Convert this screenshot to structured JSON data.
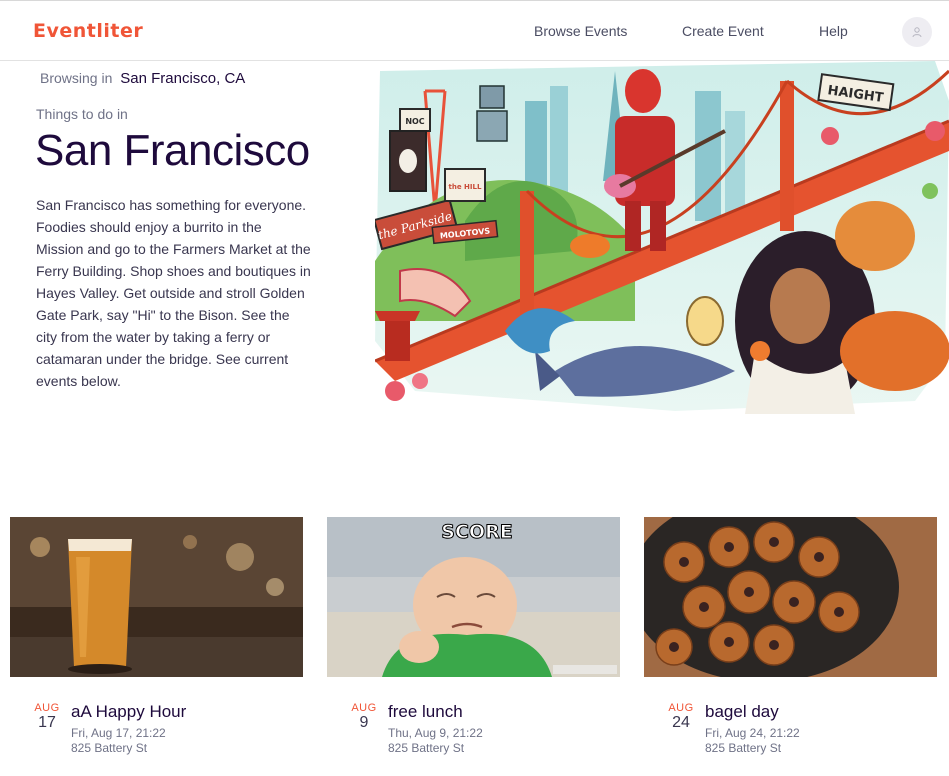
{
  "header": {
    "logo": "Eventliter",
    "nav": [
      {
        "label": "Browse Events"
      },
      {
        "label": "Create Event"
      },
      {
        "label": "Help"
      }
    ]
  },
  "hero": {
    "browsing_label": "Browsing in",
    "browsing_city": "San Francisco, CA",
    "things_label": "Things to do in",
    "city": "San Francisco",
    "description": "San Francisco has something for everyone. Foodies should enjoy a burrito in the Mission and go to the Farmers Market at the Ferry Building. Shop shoes and boutiques in Hayes Valley. Get outside and stroll Golden Gate Park, say \"Hi\" to the Bison. See the city from the water by taking a ferry or catamaran under the bridge. See current events below.",
    "art_signs": [
      "HAIGHT",
      "NOC",
      "the Parkside",
      "MOLOTOVS",
      "the HILL"
    ]
  },
  "events": [
    {
      "month": "AUG",
      "day": "17",
      "title": "aA Happy Hour",
      "time": "Fri, Aug 17, 21:22",
      "place": "825 Battery St"
    },
    {
      "month": "AUG",
      "day": "9",
      "title": "free lunch",
      "time": "Thu, Aug 9, 21:22",
      "place": "825 Battery St",
      "image_caption": "SCORE"
    },
    {
      "month": "AUG",
      "day": "24",
      "title": "bagel day",
      "time": "Fri, Aug 24, 21:22",
      "place": "825 Battery St"
    }
  ],
  "colors": {
    "brand": "#f05537",
    "title": "#1e0a3c",
    "muted": "#6f7287"
  }
}
